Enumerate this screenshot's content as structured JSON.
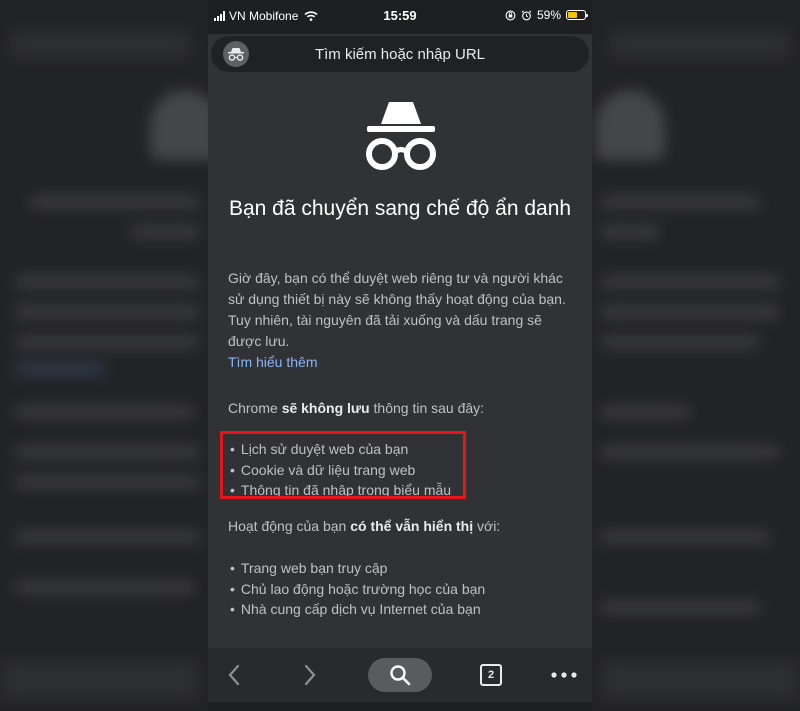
{
  "status_bar": {
    "carrier": "VN Mobifone",
    "time": "15:59",
    "battery_percent": "59%",
    "battery_level": 0.59,
    "battery_color": "#f5c400",
    "icons": [
      "signal-icon",
      "wifi-icon",
      "screen-rotation-lock-icon",
      "alarm-icon",
      "battery-icon"
    ]
  },
  "url_bar": {
    "placeholder": "Tìm kiếm hoặc nhập URL",
    "incognito_icon": "incognito-icon"
  },
  "incognito_page": {
    "hero_icon": "incognito-icon",
    "title": "Bạn đã chuyển sang chế độ ẩn danh",
    "description": "Giờ đây, bạn có thể duyệt web riêng tư và người khác sử dụng thiết bị này sẽ không thấy hoạt động của bạn. Tuy nhiên, tài nguyên đã tải xuống và dấu trang sẽ được lưu.",
    "learn_more": "Tìm hiểu thêm",
    "not_saved_prefix": "Chrome ",
    "not_saved_bold": "sẽ không lưu",
    "not_saved_suffix": " thông tin sau đây:",
    "not_saved_items": [
      "Lịch sử duyệt web của bạn",
      "Cookie và dữ liệu trang web",
      "Thông tin đã nhập trong biểu mẫu"
    ],
    "visible_prefix": "Hoạt động của bạn ",
    "visible_bold": "có thể vẫn hiển thị",
    "visible_suffix": " với:",
    "visible_items": [
      "Trang web bạn truy cập",
      "Chủ lao động hoặc trường học của bạn",
      "Nhà cung cấp dịch vụ Internet của bạn"
    ]
  },
  "toolbar": {
    "back_icon": "back-icon",
    "forward_icon": "forward-icon",
    "search_icon": "search-icon",
    "tab_count": "2",
    "more_icon": "more-icon"
  },
  "highlight_color": "#e8141c"
}
